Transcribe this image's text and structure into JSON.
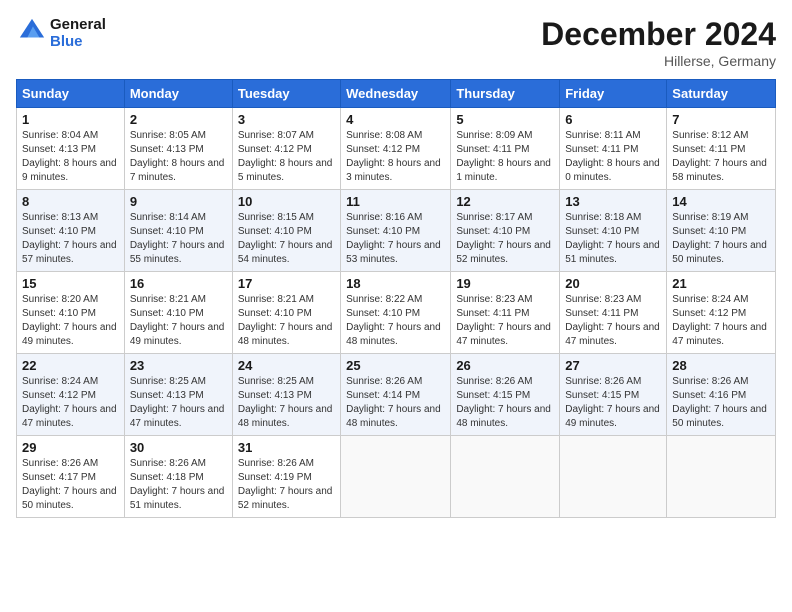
{
  "header": {
    "logo_line1": "General",
    "logo_line2": "Blue",
    "month_title": "December 2024",
    "location": "Hillerse, Germany"
  },
  "columns": [
    "Sunday",
    "Monday",
    "Tuesday",
    "Wednesday",
    "Thursday",
    "Friday",
    "Saturday"
  ],
  "weeks": [
    [
      {
        "day": "1",
        "sunrise": "Sunrise: 8:04 AM",
        "sunset": "Sunset: 4:13 PM",
        "daylight": "Daylight: 8 hours and 9 minutes."
      },
      {
        "day": "2",
        "sunrise": "Sunrise: 8:05 AM",
        "sunset": "Sunset: 4:13 PM",
        "daylight": "Daylight: 8 hours and 7 minutes."
      },
      {
        "day": "3",
        "sunrise": "Sunrise: 8:07 AM",
        "sunset": "Sunset: 4:12 PM",
        "daylight": "Daylight: 8 hours and 5 minutes."
      },
      {
        "day": "4",
        "sunrise": "Sunrise: 8:08 AM",
        "sunset": "Sunset: 4:12 PM",
        "daylight": "Daylight: 8 hours and 3 minutes."
      },
      {
        "day": "5",
        "sunrise": "Sunrise: 8:09 AM",
        "sunset": "Sunset: 4:11 PM",
        "daylight": "Daylight: 8 hours and 1 minute."
      },
      {
        "day": "6",
        "sunrise": "Sunrise: 8:11 AM",
        "sunset": "Sunset: 4:11 PM",
        "daylight": "Daylight: 8 hours and 0 minutes."
      },
      {
        "day": "7",
        "sunrise": "Sunrise: 8:12 AM",
        "sunset": "Sunset: 4:11 PM",
        "daylight": "Daylight: 7 hours and 58 minutes."
      }
    ],
    [
      {
        "day": "8",
        "sunrise": "Sunrise: 8:13 AM",
        "sunset": "Sunset: 4:10 PM",
        "daylight": "Daylight: 7 hours and 57 minutes."
      },
      {
        "day": "9",
        "sunrise": "Sunrise: 8:14 AM",
        "sunset": "Sunset: 4:10 PM",
        "daylight": "Daylight: 7 hours and 55 minutes."
      },
      {
        "day": "10",
        "sunrise": "Sunrise: 8:15 AM",
        "sunset": "Sunset: 4:10 PM",
        "daylight": "Daylight: 7 hours and 54 minutes."
      },
      {
        "day": "11",
        "sunrise": "Sunrise: 8:16 AM",
        "sunset": "Sunset: 4:10 PM",
        "daylight": "Daylight: 7 hours and 53 minutes."
      },
      {
        "day": "12",
        "sunrise": "Sunrise: 8:17 AM",
        "sunset": "Sunset: 4:10 PM",
        "daylight": "Daylight: 7 hours and 52 minutes."
      },
      {
        "day": "13",
        "sunrise": "Sunrise: 8:18 AM",
        "sunset": "Sunset: 4:10 PM",
        "daylight": "Daylight: 7 hours and 51 minutes."
      },
      {
        "day": "14",
        "sunrise": "Sunrise: 8:19 AM",
        "sunset": "Sunset: 4:10 PM",
        "daylight": "Daylight: 7 hours and 50 minutes."
      }
    ],
    [
      {
        "day": "15",
        "sunrise": "Sunrise: 8:20 AM",
        "sunset": "Sunset: 4:10 PM",
        "daylight": "Daylight: 7 hours and 49 minutes."
      },
      {
        "day": "16",
        "sunrise": "Sunrise: 8:21 AM",
        "sunset": "Sunset: 4:10 PM",
        "daylight": "Daylight: 7 hours and 49 minutes."
      },
      {
        "day": "17",
        "sunrise": "Sunrise: 8:21 AM",
        "sunset": "Sunset: 4:10 PM",
        "daylight": "Daylight: 7 hours and 48 minutes."
      },
      {
        "day": "18",
        "sunrise": "Sunrise: 8:22 AM",
        "sunset": "Sunset: 4:10 PM",
        "daylight": "Daylight: 7 hours and 48 minutes."
      },
      {
        "day": "19",
        "sunrise": "Sunrise: 8:23 AM",
        "sunset": "Sunset: 4:11 PM",
        "daylight": "Daylight: 7 hours and 47 minutes."
      },
      {
        "day": "20",
        "sunrise": "Sunrise: 8:23 AM",
        "sunset": "Sunset: 4:11 PM",
        "daylight": "Daylight: 7 hours and 47 minutes."
      },
      {
        "day": "21",
        "sunrise": "Sunrise: 8:24 AM",
        "sunset": "Sunset: 4:12 PM",
        "daylight": "Daylight: 7 hours and 47 minutes."
      }
    ],
    [
      {
        "day": "22",
        "sunrise": "Sunrise: 8:24 AM",
        "sunset": "Sunset: 4:12 PM",
        "daylight": "Daylight: 7 hours and 47 minutes."
      },
      {
        "day": "23",
        "sunrise": "Sunrise: 8:25 AM",
        "sunset": "Sunset: 4:13 PM",
        "daylight": "Daylight: 7 hours and 47 minutes."
      },
      {
        "day": "24",
        "sunrise": "Sunrise: 8:25 AM",
        "sunset": "Sunset: 4:13 PM",
        "daylight": "Daylight: 7 hours and 48 minutes."
      },
      {
        "day": "25",
        "sunrise": "Sunrise: 8:26 AM",
        "sunset": "Sunset: 4:14 PM",
        "daylight": "Daylight: 7 hours and 48 minutes."
      },
      {
        "day": "26",
        "sunrise": "Sunrise: 8:26 AM",
        "sunset": "Sunset: 4:15 PM",
        "daylight": "Daylight: 7 hours and 48 minutes."
      },
      {
        "day": "27",
        "sunrise": "Sunrise: 8:26 AM",
        "sunset": "Sunset: 4:15 PM",
        "daylight": "Daylight: 7 hours and 49 minutes."
      },
      {
        "day": "28",
        "sunrise": "Sunrise: 8:26 AM",
        "sunset": "Sunset: 4:16 PM",
        "daylight": "Daylight: 7 hours and 50 minutes."
      }
    ],
    [
      {
        "day": "29",
        "sunrise": "Sunrise: 8:26 AM",
        "sunset": "Sunset: 4:17 PM",
        "daylight": "Daylight: 7 hours and 50 minutes."
      },
      {
        "day": "30",
        "sunrise": "Sunrise: 8:26 AM",
        "sunset": "Sunset: 4:18 PM",
        "daylight": "Daylight: 7 hours and 51 minutes."
      },
      {
        "day": "31",
        "sunrise": "Sunrise: 8:26 AM",
        "sunset": "Sunset: 4:19 PM",
        "daylight": "Daylight: 7 hours and 52 minutes."
      },
      null,
      null,
      null,
      null
    ]
  ]
}
